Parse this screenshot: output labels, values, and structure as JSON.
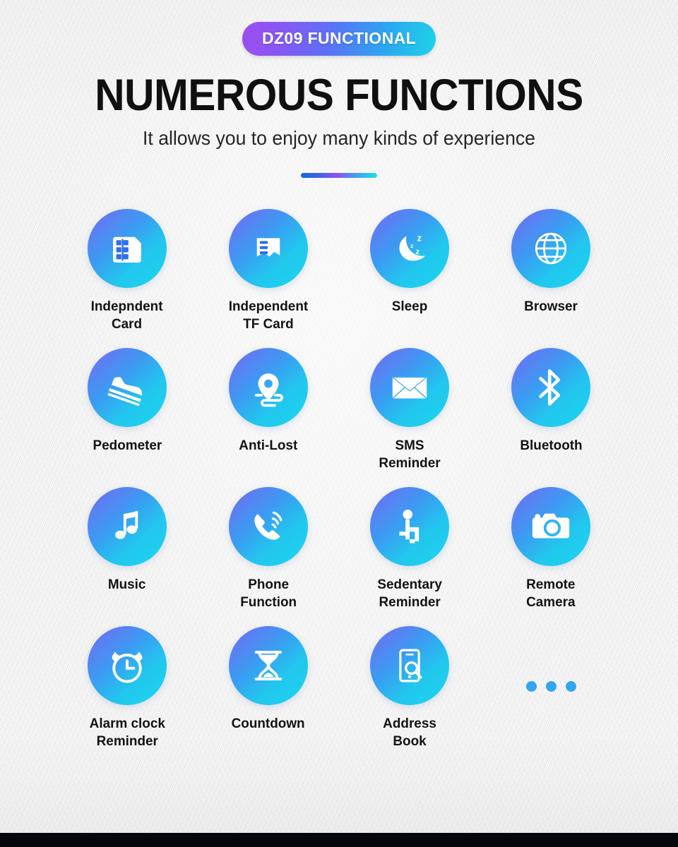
{
  "badge": {
    "label": "DZ09 FUNCTIONAL"
  },
  "heading": {
    "title": "NUMEROUS FUNCTIONS",
    "subtitle": "It allows you to enjoy many kinds of experience"
  },
  "colors": {
    "badge_gradient_start": "#9b4ff0",
    "badge_gradient_end": "#1fd3e8",
    "circle_gradient_start": "#7a63f0",
    "circle_gradient_end": "#1ad7ef",
    "divider_start": "#1464e0",
    "divider_mid": "#8a54ef",
    "divider_end": "#23e0e8",
    "background": "#ececed",
    "label_text": "#131313",
    "title_text": "#101010",
    "bottom_bar": "#05070a",
    "dot": "#33a6ef"
  },
  "features": [
    {
      "icon": "sim-card-icon",
      "label": "Indepndent\nCard"
    },
    {
      "icon": "tf-card-icon",
      "label": "Independent\nTF Card"
    },
    {
      "icon": "moon-sleep-icon",
      "label": "Sleep"
    },
    {
      "icon": "globe-icon",
      "label": "Browser"
    },
    {
      "icon": "shoe-icon",
      "label": "Pedometer"
    },
    {
      "icon": "location-pin-icon",
      "label": "Anti-Lost"
    },
    {
      "icon": "envelope-icon",
      "label": "SMS\nReminder"
    },
    {
      "icon": "bluetooth-icon",
      "label": "Bluetooth"
    },
    {
      "icon": "music-note-icon",
      "label": "Music"
    },
    {
      "icon": "phone-call-icon",
      "label": "Phone\nFunction"
    },
    {
      "icon": "sitting-person-icon",
      "label": "Sedentary\nReminder"
    },
    {
      "icon": "camera-icon",
      "label": "Remote\nCamera"
    },
    {
      "icon": "alarm-clock-icon",
      "label": "Alarm clock\nReminder"
    },
    {
      "icon": "hourglass-icon",
      "label": "Countdown"
    },
    {
      "icon": "phone-search-icon",
      "label": "Address\nBook"
    },
    {
      "icon": "ellipsis-dots-icon",
      "label": ""
    }
  ]
}
